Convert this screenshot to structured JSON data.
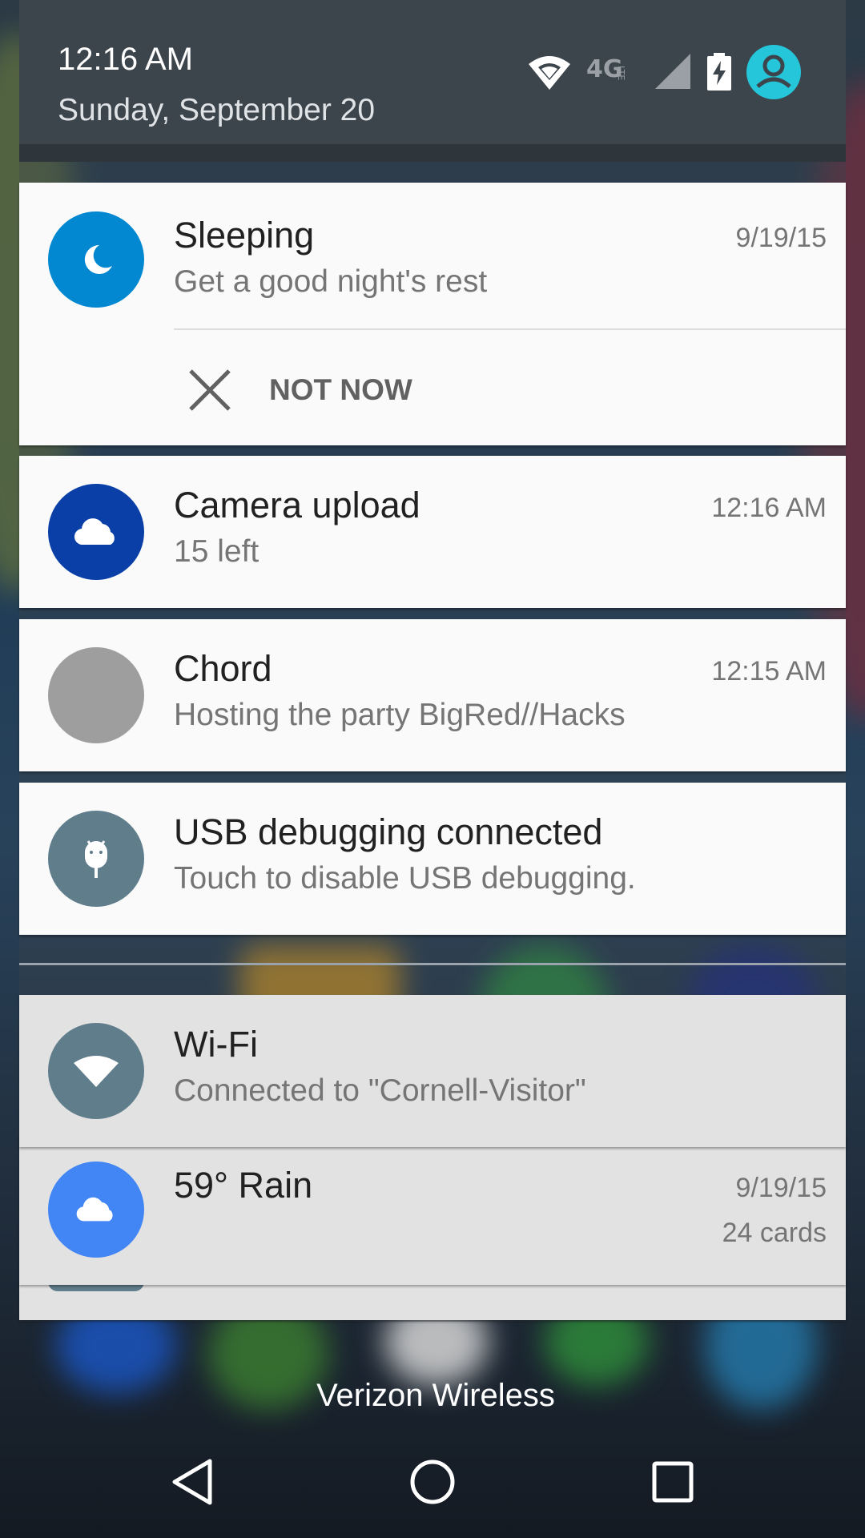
{
  "status_bar": {
    "time": "12:16 AM",
    "date": "Sunday, September 20",
    "network_label": "4G LTE",
    "icons": [
      "wifi-icon",
      "network-4g-lte-icon",
      "cell-signal-icon",
      "battery-charging-icon",
      "user-avatar-icon"
    ]
  },
  "notifications": [
    {
      "app_icon": "moon-icon",
      "icon_color": "#0288d1",
      "title": "Sleeping",
      "text": "Get a good night's rest",
      "time": "9/19/15",
      "action": {
        "icon": "close-icon",
        "label": "NOT NOW"
      }
    },
    {
      "app_icon": "cloud-icon",
      "icon_color": "#0a3fa8",
      "title": "Camera upload",
      "text": "15 left",
      "time": "12:16 AM"
    },
    {
      "app_icon": "blank-circle-icon",
      "icon_color": "#9e9e9e",
      "title": "Chord",
      "text": "Hosting the party BigRed//Hacks",
      "time": "12:15 AM"
    },
    {
      "app_icon": "android-debug-icon",
      "icon_color": "#607d8b",
      "title": "USB debugging connected",
      "text": "Touch to disable USB debugging.",
      "time": ""
    }
  ],
  "low_priority": [
    {
      "app_icon": "wifi-icon",
      "icon_color": "#607d8b",
      "title": "Wi-Fi",
      "text": "Connected to \"Cornell-Visitor\""
    },
    {
      "app_icon": "cloud-icon",
      "icon_color": "#4285f4",
      "title": "59° Rain",
      "time": "9/19/15",
      "sub": "24 cards"
    }
  ],
  "carrier": "Verizon Wireless",
  "nav": [
    "back-icon",
    "home-icon",
    "recents-icon"
  ],
  "colors": {
    "header_bg": "#3c444c",
    "card_bg": "#fafafa",
    "card_dim_bg": "#e2e2e2",
    "accent_cyan": "#26c6da"
  }
}
